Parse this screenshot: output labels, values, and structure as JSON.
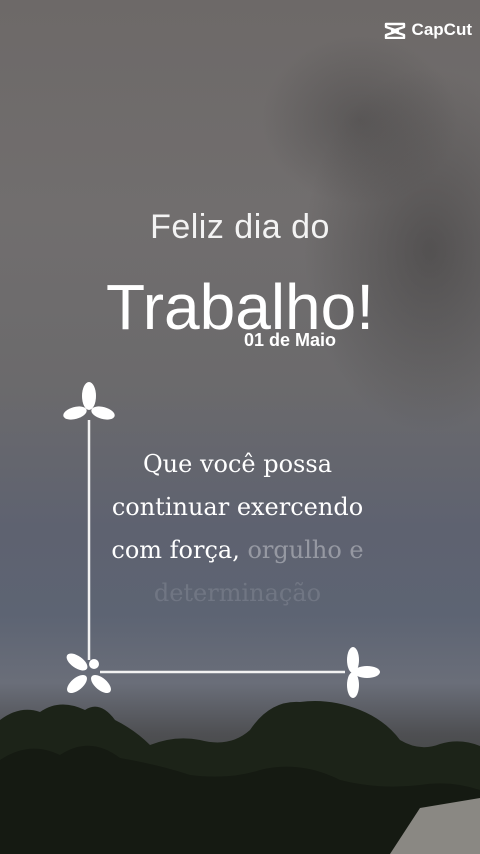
{
  "watermark": {
    "label": "CapCut",
    "icon": "capcut-logo-icon"
  },
  "greeting": {
    "line1": "Feliz dia do",
    "line2": "Trabalho!",
    "date": "01 de Maio"
  },
  "message": {
    "line1": "Que você possa",
    "line2": "continuar exercendo",
    "line3a": "com força, ",
    "line3b": "orgulho e",
    "line4": "determinação"
  },
  "decorations": {
    "icon": "flower-ornament-icon"
  }
}
